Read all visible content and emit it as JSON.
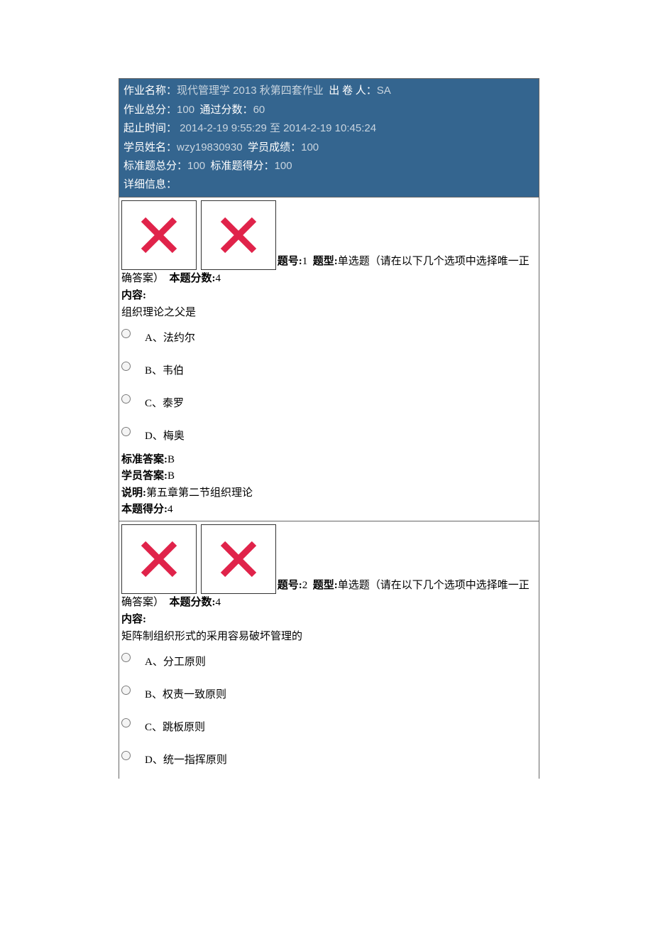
{
  "header": {
    "name_label": "作业名称：",
    "name_value": "现代管理学 2013 秋第四套作业",
    "author_label": "出 卷 人：",
    "author_value": "SA",
    "total_label": "作业总分：",
    "total_value": "100",
    "pass_label": "通过分数：",
    "pass_value": "60",
    "time_label": "起止时间：",
    "time_value": " 2014-2-19 9:55:29 至 2014-2-19 10:45:24",
    "student_label": "学员姓名：",
    "student_value": "wzy19830930",
    "score_label": "学员成绩：",
    "score_value": "100",
    "std_total_label": "标准题总分：",
    "std_total_value": "100",
    "std_score_label": "标准题得分：",
    "std_score_value": "100",
    "detail_label": "详细信息："
  },
  "questions": [
    {
      "num_label": "题号:",
      "num_value": "1",
      "type_label": "题型:",
      "type_value": "单选题（请在以下几个选项中选择唯一正确答案）",
      "score_label": "本题分数:",
      "score_value": "4",
      "content_label": "内容:",
      "content_text": "组织理论之父是",
      "options": [
        "A、法约尔",
        "B、韦伯",
        "C、泰罗",
        "D、梅奥"
      ],
      "std_ans_label": "标准答案:",
      "std_ans_value": "B",
      "stu_ans_label": "学员答案:",
      "stu_ans_value": "B",
      "explain_label": "说明:",
      "explain_value": "第五章第二节组织理论",
      "got_label": "本题得分:",
      "got_value": "4"
    },
    {
      "num_label": "题号:",
      "num_value": "2",
      "type_label": "题型:",
      "type_value": "单选题（请在以下几个选项中选择唯一正确答案）",
      "score_label": "本题分数:",
      "score_value": "4",
      "content_label": "内容:",
      "content_text": "矩阵制组织形式的采用容易破坏管理的",
      "options": [
        "A、分工原则",
        "B、权责一致原则",
        "C、跳板原则",
        "D、统一指挥原则"
      ]
    }
  ]
}
